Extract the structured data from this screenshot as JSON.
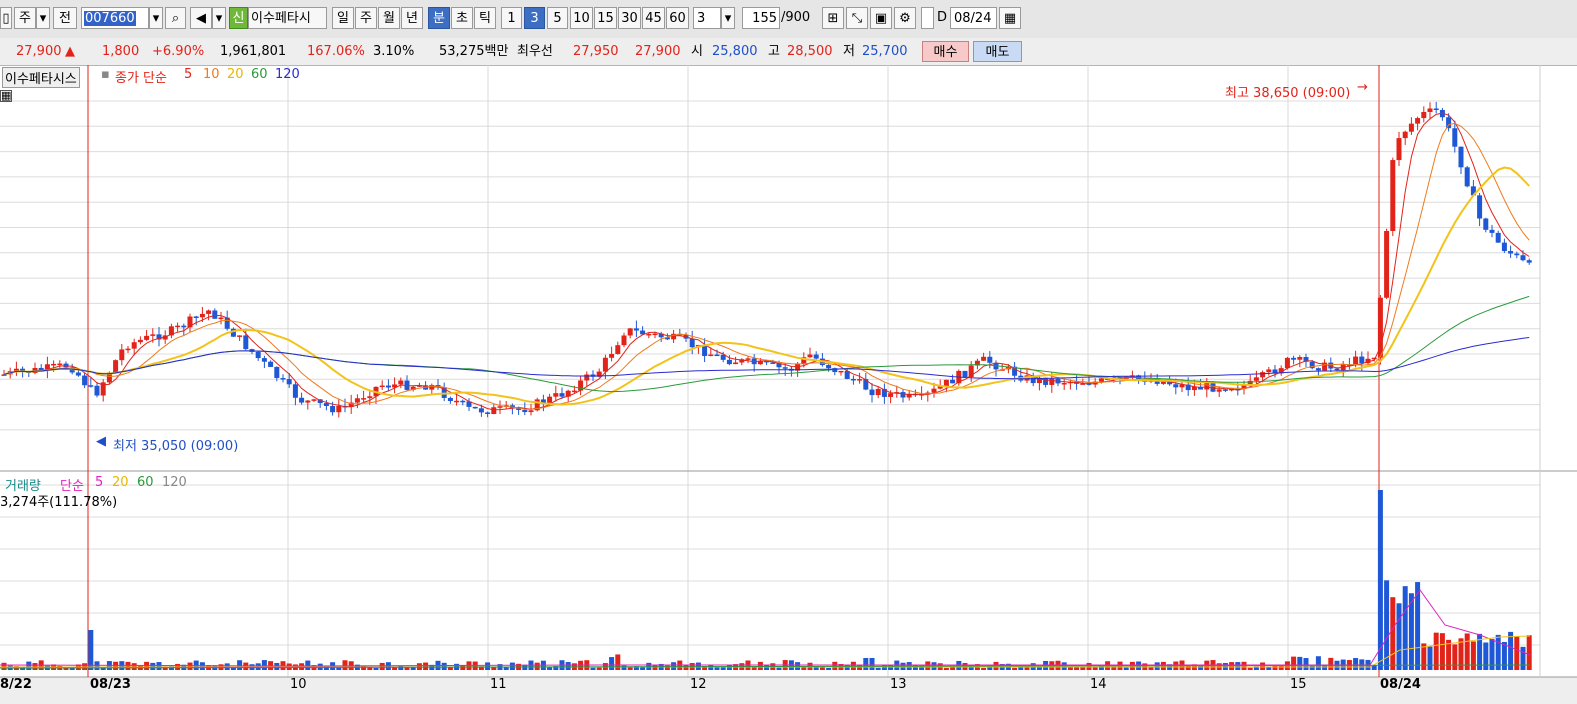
{
  "toolbar": {
    "period_btn": "주",
    "prev_btn": "전",
    "code": "007660",
    "credit_badge": "신",
    "stock_name": "이수페타시",
    "tabs": [
      "일",
      "주",
      "월",
      "년",
      "분",
      "초",
      "틱"
    ],
    "minutes": [
      "1",
      "3",
      "5",
      "10",
      "15",
      "30",
      "45",
      "60"
    ],
    "interval_value": "3",
    "count_value": "155",
    "count_total": "/900",
    "d_label": "D",
    "date_value": "08/24"
  },
  "quote": {
    "price": "27,900",
    "arrow": "▲",
    "change": "1,800",
    "change_pct": "+6.90%",
    "volume": "1,961,801",
    "volume_ratio": "167.06%",
    "turnover": "3.10%",
    "amount": "53,275백만",
    "best_label": "최우선",
    "best_ask": "27,950",
    "best_bid": "27,900",
    "open_label": "시",
    "open": "25,800",
    "high_label": "고",
    "high": "28,500",
    "low_label": "저",
    "low": "25,700",
    "buy_btn": "매수",
    "sell_btn": "매도"
  },
  "price_legend": {
    "name": "이수페타시스",
    "type": "종가 단순",
    "periods": [
      "5",
      "10",
      "20",
      "60",
      "120"
    ]
  },
  "volume_legend": {
    "name": "거래량",
    "type": "단순",
    "periods": [
      "5",
      "20",
      "60",
      "120"
    ],
    "value": "3,274주(111.78%)"
  },
  "annotations": {
    "high": "최고 38,650 (09:00)",
    "low": "최저 35,050 (09:00)"
  },
  "x_labels": [
    "8/22",
    "08/23",
    "10",
    "11",
    "12",
    "13",
    "14",
    "15",
    "08/24"
  ],
  "colors": {
    "up": "#e2231a",
    "down": "#1f58d6",
    "ma5": "#e2231a",
    "ma10": "#f07a1a",
    "ma20": "#f2c31a",
    "ma60": "#2a9a3a",
    "ma120": "#2b2bd0",
    "vma5": "#e020c0"
  }
}
